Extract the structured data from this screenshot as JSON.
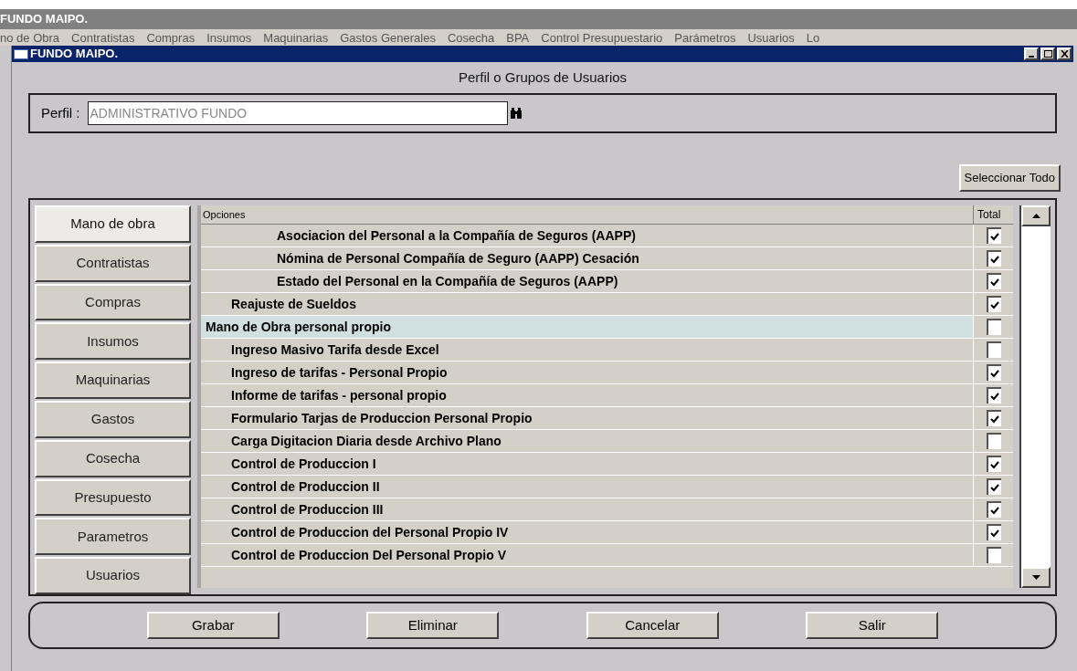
{
  "app": {
    "title": "FUNDO MAIPO."
  },
  "menu": [
    "no de Obra",
    "Contratistas",
    "Compras",
    "Insumos",
    "Maquinarias",
    "Gastos Generales",
    "Cosecha",
    "BPA",
    "Control Presupuestario",
    "Parámetros",
    "Usuarios",
    "Lo"
  ],
  "window": {
    "title": "FUNDO MAIPO.",
    "heading": "Perfil o Grupos de Usuarios"
  },
  "profile": {
    "label": "Perfil :",
    "value": "ADMINISTRATIVO FUNDO"
  },
  "select_all_button": "Seleccionar Todo",
  "tabs": [
    {
      "label": "Mano de obra",
      "selected": true
    },
    {
      "label": "Contratistas",
      "selected": false
    },
    {
      "label": "Compras",
      "selected": false
    },
    {
      "label": "Insumos",
      "selected": false
    },
    {
      "label": "Maquinarias",
      "selected": false
    },
    {
      "label": "Gastos",
      "selected": false
    },
    {
      "label": "Cosecha",
      "selected": false
    },
    {
      "label": "Presupuesto",
      "selected": false
    },
    {
      "label": "Parametros",
      "selected": false
    },
    {
      "label": "Usuarios",
      "selected": false
    }
  ],
  "grid": {
    "columns": [
      "Opciones",
      "Total"
    ],
    "options": [
      {
        "children": [
          {
            "children": [
              {
                "label": "Asociacion del Personal a la Compañía de Seguros (AAPP)",
                "checked": true,
                "selected": false
              },
              {
                "label": "Nómina de Personal Compañía de Seguro (AAPP) Cesación",
                "checked": true,
                "selected": false
              },
              {
                "label": "Estado del Personal en la Compañía de Seguros (AAPP)",
                "checked": true,
                "selected": false
              }
            ]
          },
          {
            "label": "Reajuste de Sueldos",
            "checked": true,
            "selected": false
          }
        ]
      },
      {
        "label": "Mano de Obra personal propio",
        "checked": false,
        "selected": true,
        "children": [
          {
            "label": "Ingreso Masivo Tarifa desde Excel",
            "checked": false,
            "selected": false
          },
          {
            "label": "Ingreso de tarifas - Personal Propio",
            "checked": true,
            "selected": false
          },
          {
            "label": "Informe de tarifas - personal propio",
            "checked": true,
            "selected": false
          },
          {
            "label": "Formulario Tarjas de Produccion Personal Propio",
            "checked": true,
            "selected": false
          },
          {
            "label": "Carga Digitacion Diaria desde Archivo Plano",
            "checked": false,
            "selected": false
          },
          {
            "label": "Control de Produccion I",
            "checked": true,
            "selected": false
          },
          {
            "label": "Control de Produccion II",
            "checked": true,
            "selected": false
          },
          {
            "label": "Control de Produccion III",
            "checked": true,
            "selected": false
          },
          {
            "label": "Control de Produccion del Personal Propio IV",
            "checked": true,
            "selected": false
          },
          {
            "label": "Control de Produccion Del Personal Propio V",
            "checked": false,
            "selected": false
          }
        ]
      }
    ]
  },
  "buttons": [
    "Grabar",
    "Eliminar",
    "Cancelar",
    "Salir"
  ]
}
